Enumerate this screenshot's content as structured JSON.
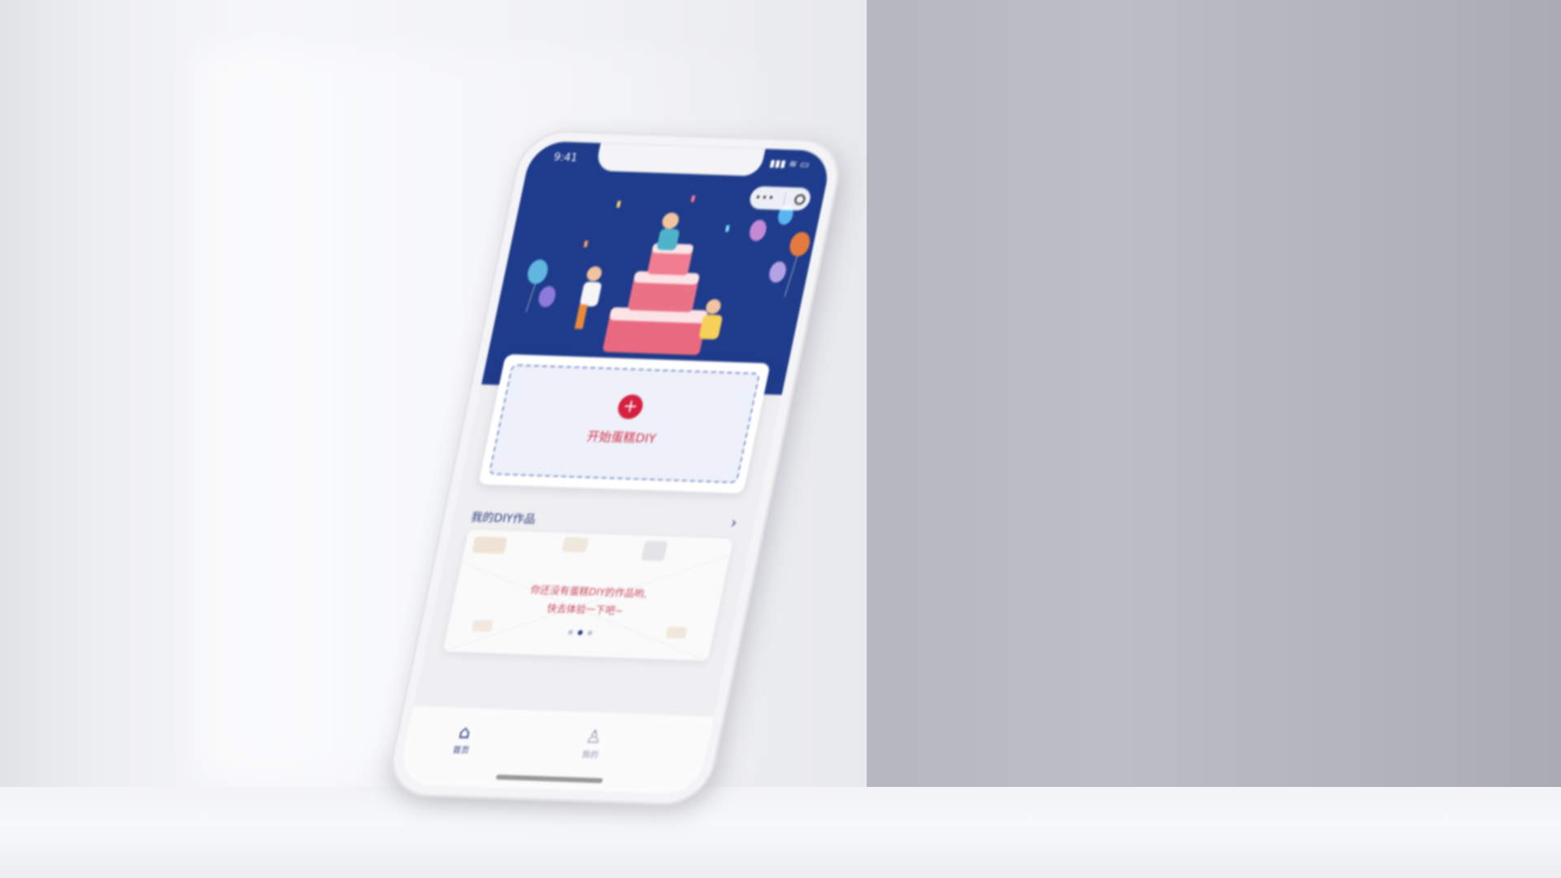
{
  "status_bar": {
    "time": "9:41",
    "signal_icons": "▮▮▮ ≋ ▭"
  },
  "capsule": {
    "menu_icon": "more-icon",
    "close_icon": "close-ring-icon"
  },
  "diy": {
    "plus": "+",
    "label": "开始蛋糕DIY"
  },
  "works": {
    "title": "我的DIY作品",
    "arrow": "›",
    "empty_line1": "你还没有蛋糕DIY的作品哟,",
    "empty_line2": "快去体验一下吧~",
    "pager_count": 3,
    "pager_active": 1
  },
  "tabbar": {
    "home_label": "首页",
    "mine_label": "我的"
  },
  "colors": {
    "hero_bg": "#1f3b8b",
    "accent_red": "#d5213f",
    "text_blue": "#2a3a7c"
  }
}
